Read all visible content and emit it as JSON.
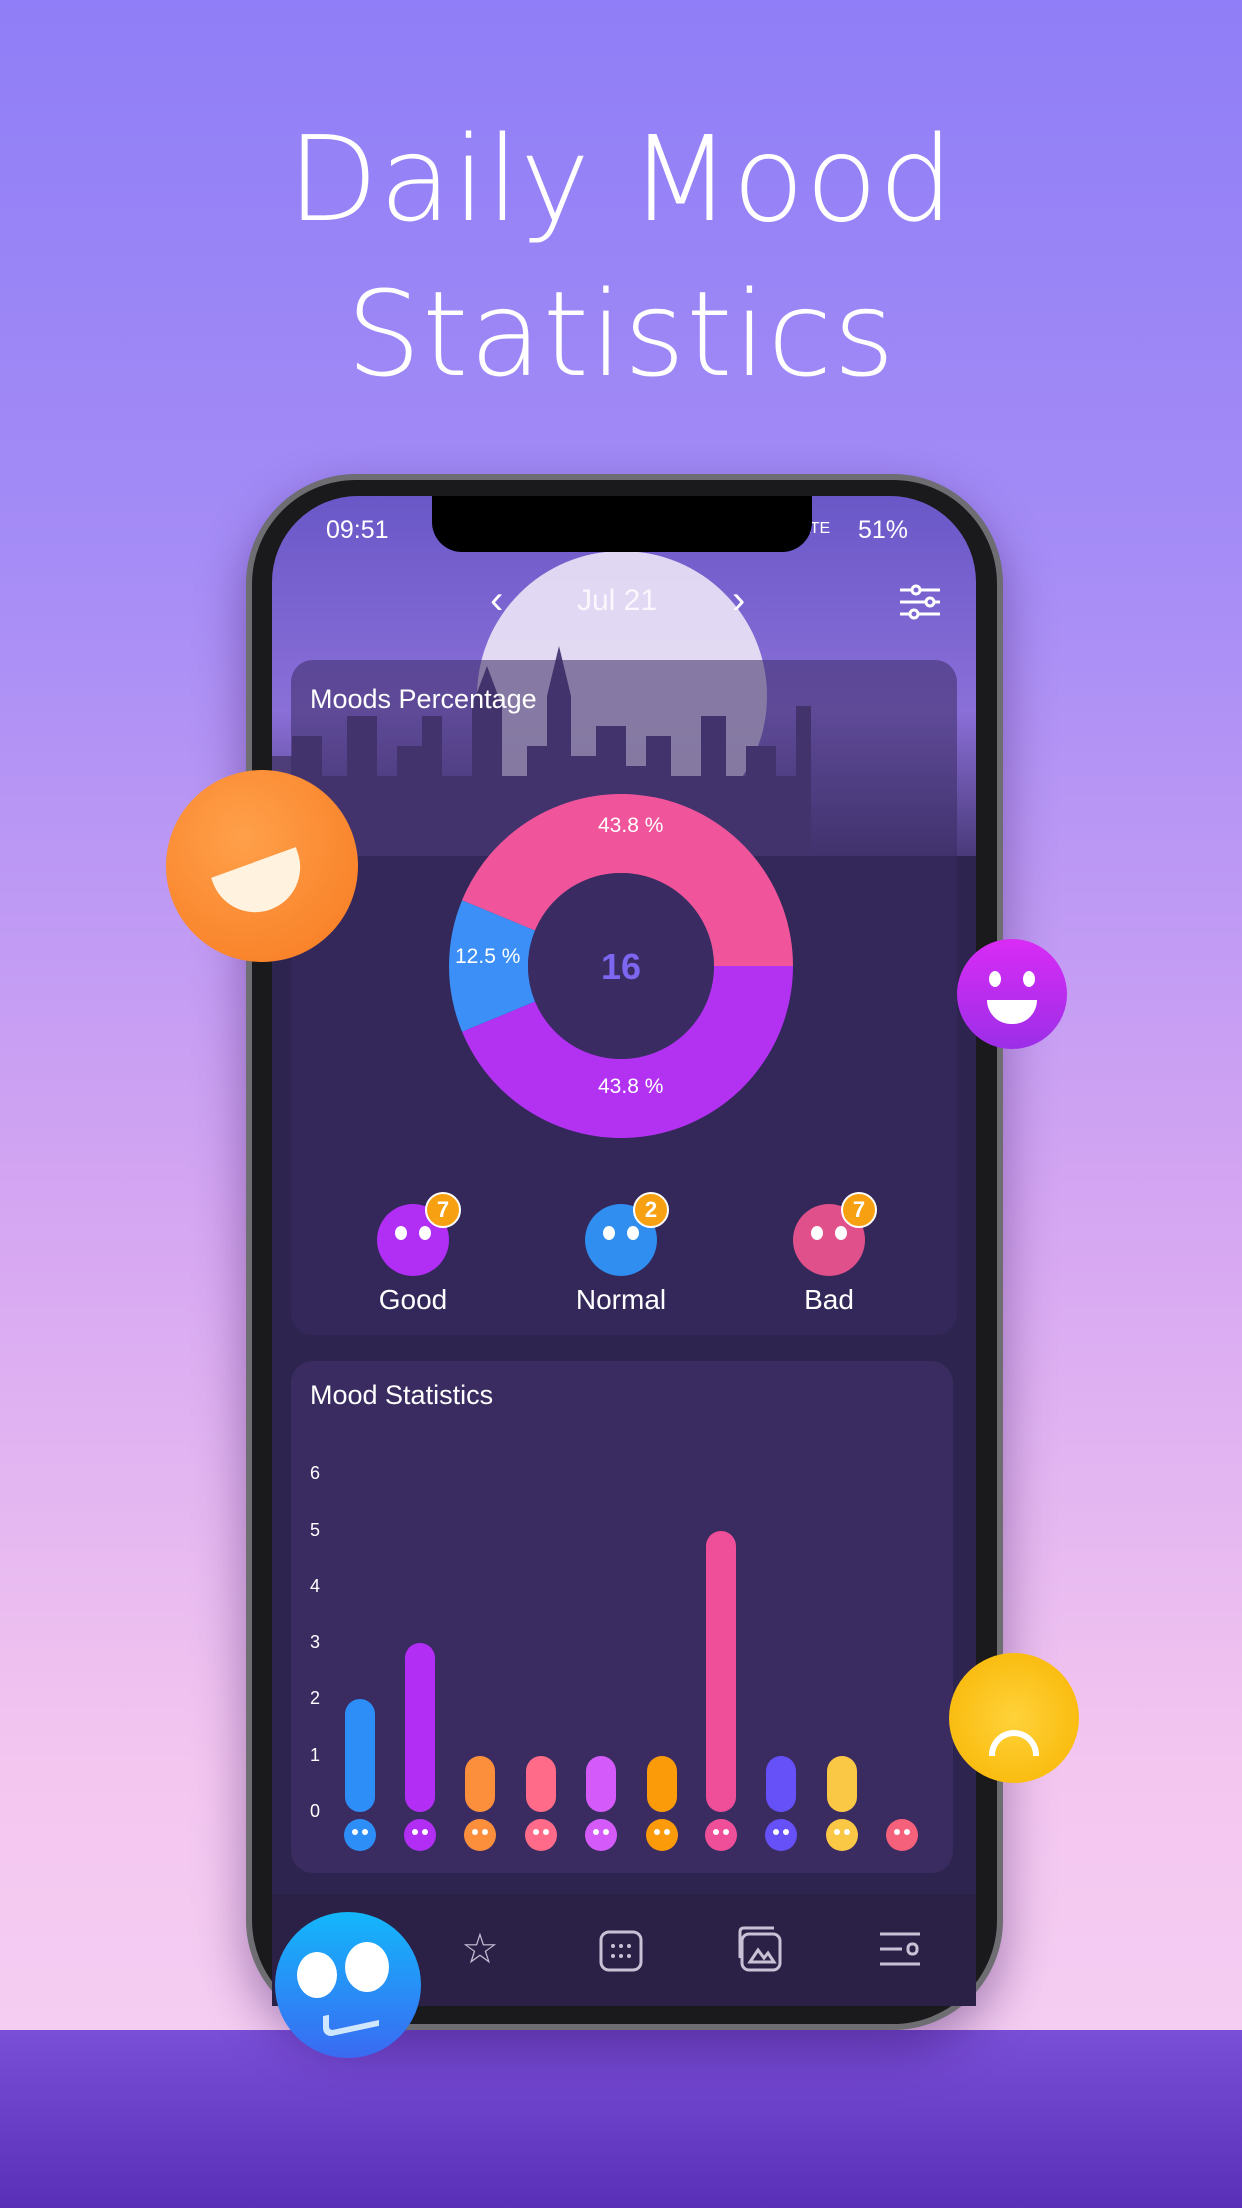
{
  "headline": {
    "line1": "Daily Mood",
    "line2": "Statistics"
  },
  "status_bar": {
    "time": "09:51",
    "network": "LTE",
    "battery": "51%"
  },
  "header": {
    "month": "Jul 21",
    "prev_icon": "chevron-left-icon",
    "next_icon": "chevron-right-icon",
    "filter_icon": "sliders-icon"
  },
  "moods_percentage": {
    "title": "Moods Percentage",
    "total": "16",
    "slices": [
      {
        "label": "43.8 %",
        "value": 43.8,
        "color": "#b332f2"
      },
      {
        "label": "12.5 %",
        "value": 12.5,
        "color": "#3b8ff6"
      },
      {
        "label": "43.8 %",
        "value": 43.8,
        "color": "#f0559c"
      }
    ],
    "groups": [
      {
        "name": "Good",
        "count": "7",
        "color": "#b12ef5"
      },
      {
        "name": "Normal",
        "count": "2",
        "color": "#2f8ef0"
      },
      {
        "name": "Bad",
        "count": "7",
        "color": "#e0508a"
      }
    ]
  },
  "chart_data": {
    "type": "bar",
    "title": "Mood Statistics",
    "yticks": [
      "0",
      "1",
      "2",
      "3",
      "4",
      "5",
      "6"
    ],
    "ylim": [
      0,
      6
    ],
    "categories": [
      "confused",
      "happy",
      "laughing",
      "star-eyes",
      "cool",
      "zipped",
      "shocked",
      "stressed",
      "worried",
      "angry"
    ],
    "values": [
      2,
      3,
      1,
      1,
      1,
      1,
      5,
      1,
      1,
      0
    ],
    "colors": [
      "#2e8ef8",
      "#b22ef5",
      "#fb8f3c",
      "#ff6b88",
      "#d45bfa",
      "#fb9b0a",
      "#ee4f98",
      "#6650f8",
      "#fbc845",
      "#f5607a"
    ]
  },
  "bottom_nav": [
    {
      "icon": "mood-icon"
    },
    {
      "icon": "star-icon"
    },
    {
      "icon": "calendar-icon"
    },
    {
      "icon": "gallery-icon"
    },
    {
      "icon": "settings-icon"
    }
  ]
}
